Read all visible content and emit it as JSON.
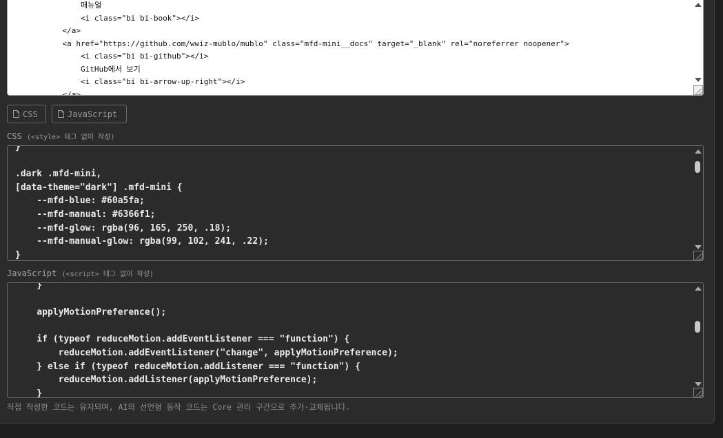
{
  "html_editor": {
    "lines": [
      "                매뉴얼",
      "                <i class=\"bi bi-book\"></i>",
      "            </a>",
      "            <a href=\"https://github.com/wwiz-mublo/mublo\" class=\"mfd-mini__docs\" target=\"_blank\" rel=\"noreferrer noopener\">",
      "                <i class=\"bi bi-github\"></i>",
      "                GitHub에서 보기",
      "                <i class=\"bi bi-arrow-up-right\"></i>",
      "            </a>"
    ]
  },
  "tabs": {
    "css_label": "CSS",
    "js_label": "JavaScript"
  },
  "css_section": {
    "label": "CSS",
    "hint": "(<style> 태그 없이 작성)",
    "lines": [
      "}",
      "",
      ".dark .mfd-mini,",
      "[data-theme=\"dark\"] .mfd-mini {",
      "    --mfd-blue: #60a5fa;",
      "    --mfd-manual: #6366f1;",
      "    --mfd-glow: rgba(96, 165, 250, .18);",
      "    --mfd-manual-glow: rgba(99, 102, 241, .22);",
      "}"
    ]
  },
  "js_section": {
    "label": "JavaScript",
    "hint": "(<script> 태그 없이 작성)",
    "lines": [
      "    }",
      "",
      "    applyMotionPreference();",
      "",
      "    if (typeof reduceMotion.addEventListener === \"function\") {",
      "        reduceMotion.addEventListener(\"change\", applyMotionPreference);",
      "    } else if (typeof reduceMotion.addListener === \"function\") {",
      "        reduceMotion.addListener(applyMotionPreference);",
      "    }"
    ]
  },
  "footer_note": "직접 작성한 코드는 유지되며, AI의 선언형 동작 코드는 Core 관리 구간으로 추가·교체됩니다.",
  "icons": {
    "tab_icon": "file-icon",
    "scroll_up": "triangle-up-icon",
    "scroll_down": "triangle-down-icon",
    "resize": "resize-grip-icon"
  }
}
